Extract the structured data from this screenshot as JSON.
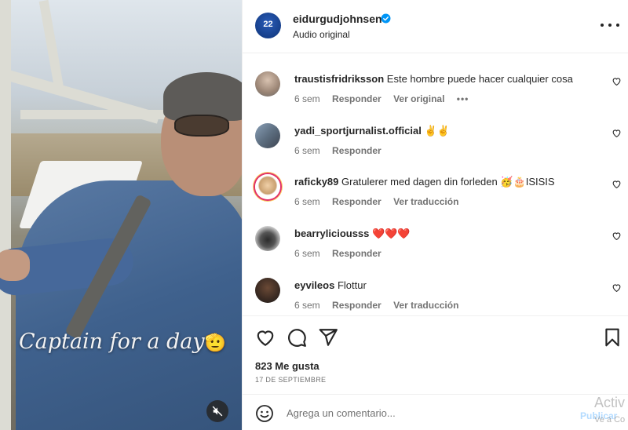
{
  "media": {
    "caption": "Captain for a day",
    "caption_emoji": "🫡",
    "mute_icon": "speaker-muted-icon"
  },
  "post": {
    "username": "eidurgudjohnsen",
    "subtitle": "Audio original",
    "avatar_number": "22",
    "verified_color": "#0095f6"
  },
  "comments": [
    {
      "user": "traustisfridriksson",
      "text": "Este hombre puede hacer cualquier cosa",
      "time": "6 sem",
      "reply": "Responder",
      "extra": "Ver original",
      "more": "•••"
    },
    {
      "user": "yadi_sportjurnalist.official",
      "text": "✌️✌️",
      "time": "6 sem",
      "reply": "Responder",
      "extra": "",
      "more": ""
    },
    {
      "user": "raficky89",
      "text": "Gratulerer med dagen din forleden 🥳🎂ISISIS",
      "time": "6 sem",
      "reply": "Responder",
      "extra": "Ver traducción",
      "more": ""
    },
    {
      "user": "bearryliciousss",
      "text": "❤️❤️❤️",
      "time": "6 sem",
      "reply": "Responder",
      "extra": "",
      "more": ""
    },
    {
      "user": "eyvileos",
      "text": "Flottur",
      "time": "6 sem",
      "reply": "Responder",
      "extra": "Ver traducción",
      "more": ""
    }
  ],
  "actions": {
    "likes": "823 Me gusta",
    "date": "17 DE SEPTIEMBRE"
  },
  "composer": {
    "placeholder": "Agrega un comentario...",
    "publish": "Publicar"
  },
  "watermark": {
    "line1": "Activ",
    "line2": "Ve a Co"
  },
  "colors": {
    "text": "#262626",
    "secondary": "#737373",
    "link_disabled": "#b3dbff",
    "heart_red": "#ed4956"
  }
}
